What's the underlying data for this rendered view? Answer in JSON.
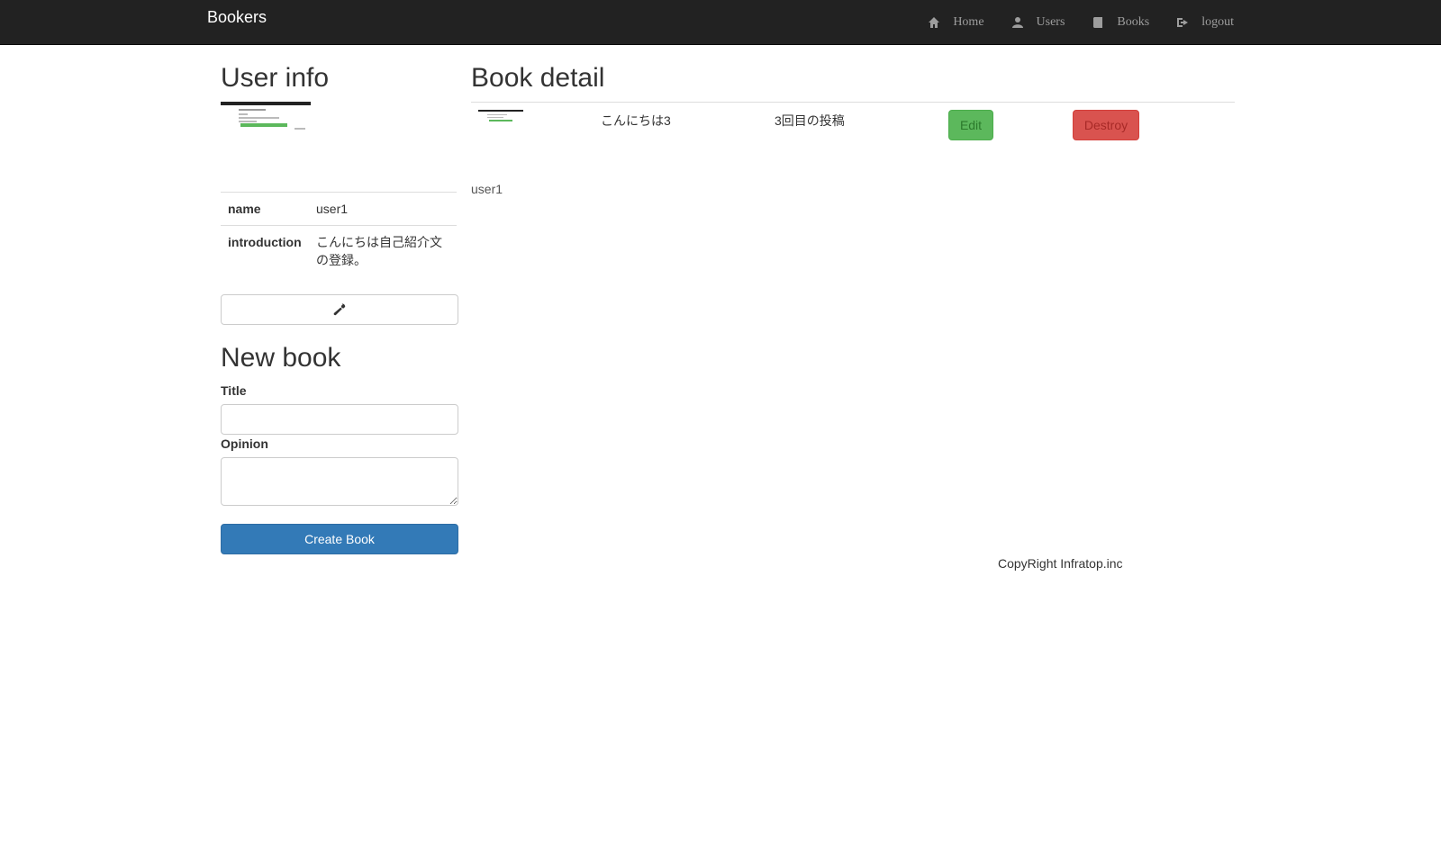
{
  "navbar": {
    "brand": "Bookers",
    "items": [
      {
        "label": "Home",
        "icon": "home-icon"
      },
      {
        "label": "Users",
        "icon": "user-icon"
      },
      {
        "label": "Books",
        "icon": "book-icon"
      },
      {
        "label": "logout",
        "icon": "logout-icon"
      }
    ]
  },
  "user_info": {
    "heading": "User info",
    "rows": [
      {
        "key": "name",
        "value": "user1"
      },
      {
        "key": "introduction",
        "value": "こんにちは自己紹介文の登録。"
      }
    ],
    "edit_icon": "wrench-icon"
  },
  "new_book": {
    "heading": "New book",
    "title_label": "Title",
    "title_value": "",
    "opinion_label": "Opinion",
    "opinion_value": "",
    "submit_label": "Create Book"
  },
  "book_detail": {
    "heading": "Book detail",
    "book": {
      "title": "こんにちは3",
      "opinion": "3回目の投稿",
      "edit_label": "Edit",
      "destroy_label": "Destroy"
    },
    "user_name": "user1"
  },
  "footer": {
    "text": "CopyRight Infratop.inc"
  },
  "colors": {
    "navbar_bg": "#222222",
    "primary": "#337ab7",
    "success": "#5cb85c",
    "danger": "#d9534f"
  }
}
